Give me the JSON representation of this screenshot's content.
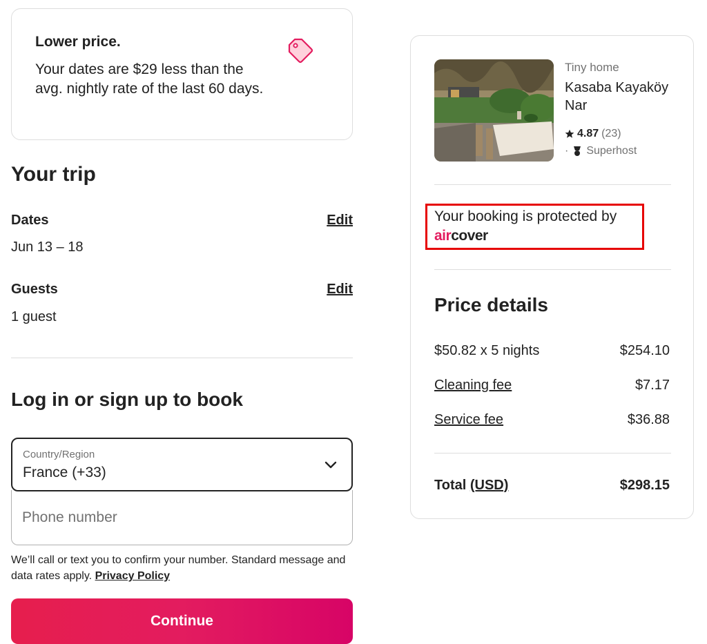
{
  "lower_price": {
    "title": "Lower price.",
    "body": "Your dates are $29 less than the avg. nightly rate of the last 60 days.",
    "icon": "price-tag-icon",
    "accent": "#e31c5f"
  },
  "trip": {
    "title": "Your trip",
    "dates_label": "Dates",
    "dates_value": "Jun 13 – 18",
    "guests_label": "Guests",
    "guests_value": "1 guest",
    "edit_label": "Edit"
  },
  "login": {
    "title": "Log in or sign up to book",
    "country_label": "Country/Region",
    "country_value": "France (+33)",
    "phone_placeholder": "Phone number",
    "disclaimer": "We’ll call or text you to confirm your number. Standard message and data rates apply.",
    "privacy_link": "Privacy Policy",
    "continue_label": "Continue"
  },
  "listing": {
    "type": "Tiny home",
    "name": "Kasaba Kayaköy Nar",
    "rating": "4.87",
    "reviews": "(23)",
    "separator": "·",
    "host_badge": "Superhost"
  },
  "protection": {
    "text": "Your booking is protected by",
    "brand_air": "air",
    "brand_cover": "cover",
    "highlight_color": "#e60000"
  },
  "price_details": {
    "title": "Price details",
    "lines": [
      {
        "label": "$50.82 x 5 nights",
        "amount": "$254.10"
      },
      {
        "label": "Cleaning fee",
        "amount": "$7.17"
      },
      {
        "label": "Service fee",
        "amount": "$36.88"
      }
    ],
    "total_label": "Total",
    "total_currency": "(USD)",
    "total_amount": "$298.15"
  },
  "colors": {
    "brand": "#e31c5f",
    "text": "#222222",
    "muted": "#717171",
    "border": "#dddddd"
  }
}
